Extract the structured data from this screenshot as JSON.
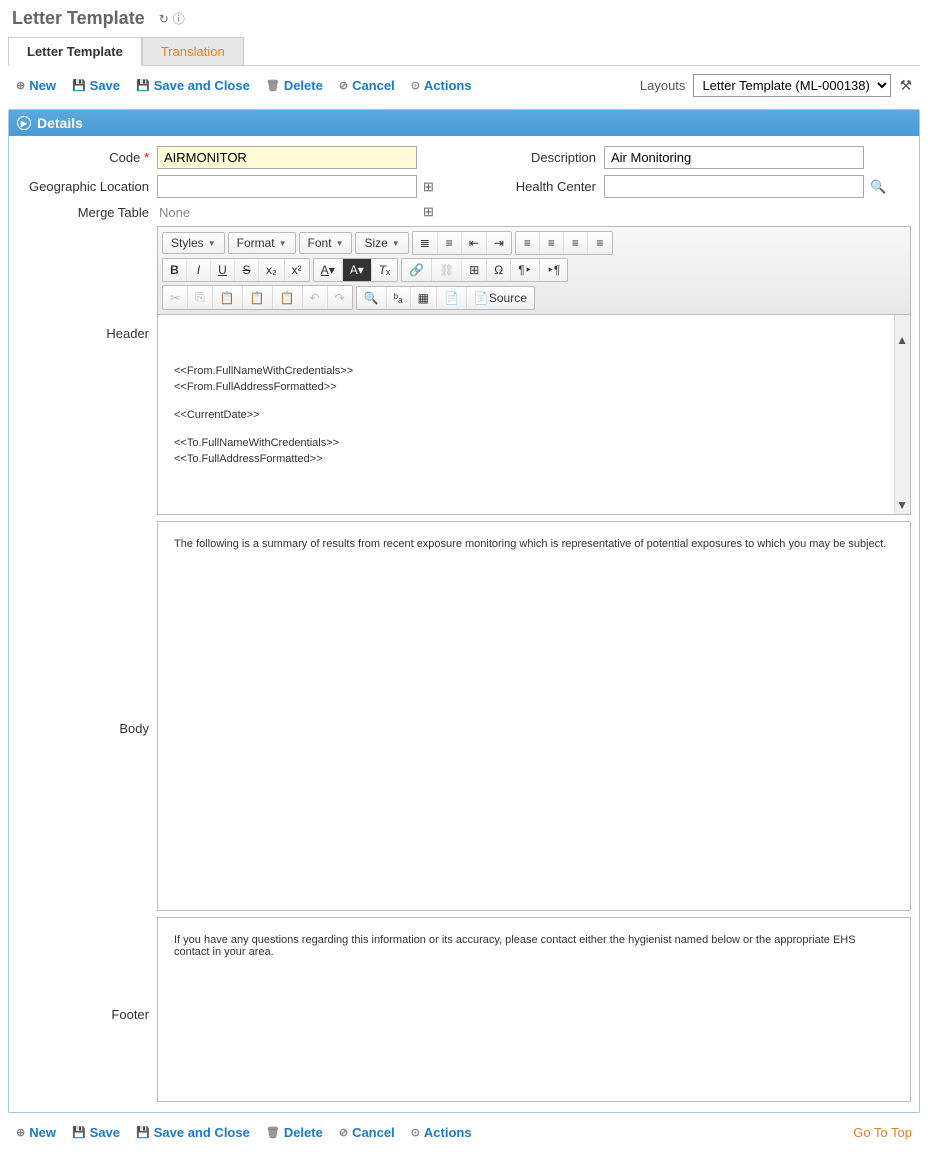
{
  "page": {
    "title": "Letter Template"
  },
  "tabs": [
    {
      "label": "Letter Template",
      "active": true
    },
    {
      "label": "Translation",
      "active": false
    }
  ],
  "toolbar": {
    "new": "New",
    "save": "Save",
    "saveClose": "Save and Close",
    "delete": "Delete",
    "cancel": "Cancel",
    "actions": "Actions",
    "layoutsLabel": "Layouts",
    "layoutsValue": "Letter Template (ML-000138)"
  },
  "panel": {
    "title": "Details"
  },
  "fields": {
    "codeLabel": "Code",
    "codeValue": "AIRMONITOR",
    "descLabel": "Description",
    "descValue": "Air Monitoring",
    "geoLabel": "Geographic Location",
    "geoValue": "",
    "hcLabel": "Health Center",
    "hcValue": "",
    "mergeLabel": "Merge Table",
    "mergeValue": "None"
  },
  "editor": {
    "headerLabel": "Header",
    "bodyLabel": "Body",
    "footerLabel": "Footer",
    "styles": "Styles",
    "format": "Format",
    "font": "Font",
    "size": "Size",
    "source": "Source",
    "headerContent": [
      "<<From.FullNameWithCredentials>>",
      "<<From.FullAddressFormatted>>",
      "",
      "<<CurrentDate>>",
      "",
      "<<To.FullNameWithCredentials>>",
      "<<To.FullAddressFormatted>>"
    ],
    "bodyContent": "The following is a summary of results from recent exposure monitoring which is representative of potential exposures to which you may be subject.",
    "footerContent": "If you have any questions regarding this information or its accuracy, please contact either the hygienist named below or the appropriate EHS contact in your area."
  },
  "footer": {
    "goToTop": "Go To Top"
  }
}
